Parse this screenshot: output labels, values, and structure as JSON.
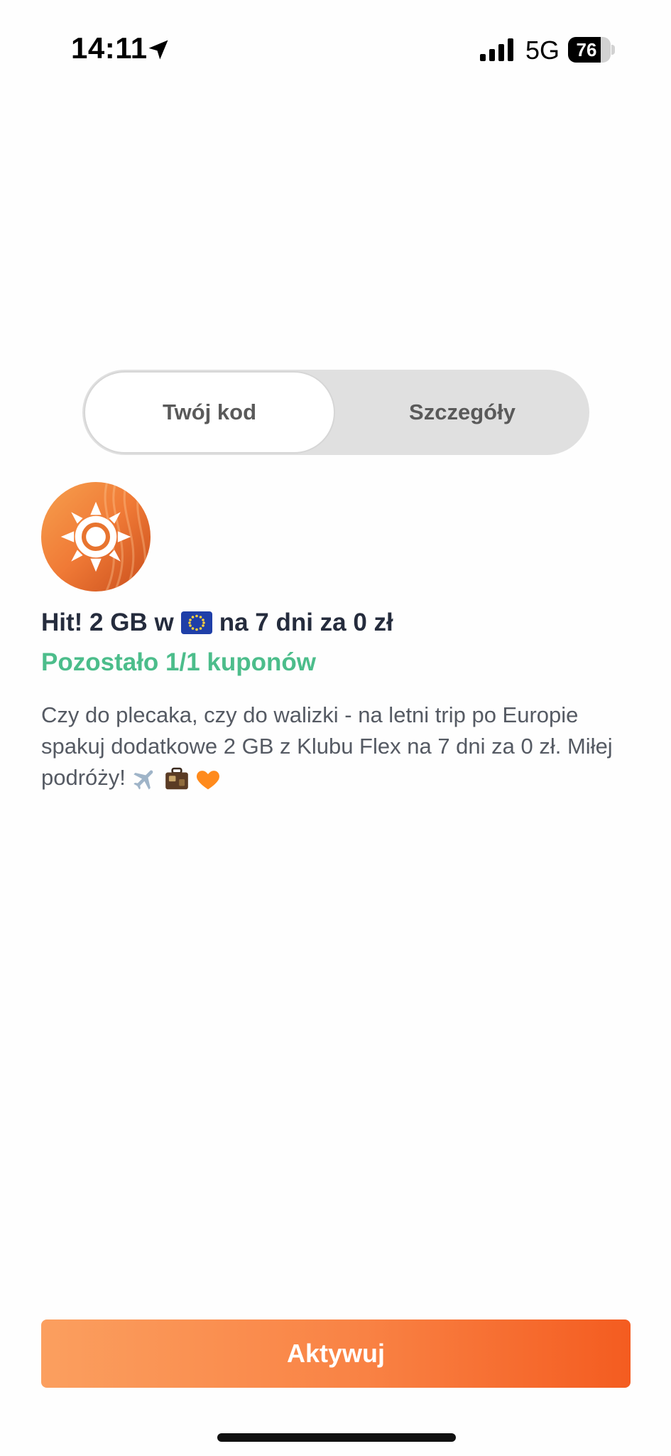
{
  "status_bar": {
    "time": "14:11",
    "network": "5G",
    "battery_level": "76",
    "battery_fraction": 0.76
  },
  "segmented_control": {
    "tabs": [
      {
        "label": "Twój kod",
        "selected": true
      },
      {
        "label": "Szczegóły",
        "selected": false
      }
    ]
  },
  "offer": {
    "icon": "sun-icon",
    "title_before_flag": "Hit! 2 GB w",
    "title_flag": "eu-flag-icon",
    "title_after_flag": "na 7 dni za 0 zł",
    "remaining": "Pozostało 1/1 kuponów",
    "description": "Czy do plecaka, czy do walizki - na letni trip po Europie spakuj dodatkowe 2 GB z Klubu Flex na 7 dni za 0 zł. Miłej podróży!",
    "description_emojis": [
      "airplane-icon",
      "suitcase-icon",
      "orange-heart-icon"
    ]
  },
  "actions": {
    "activate_label": "Aktywuj"
  },
  "colors": {
    "accent_start": "#fb9f5f",
    "accent_end": "#f45c20",
    "remaining_green": "#4cbd8b",
    "title_text": "#252c3d"
  }
}
